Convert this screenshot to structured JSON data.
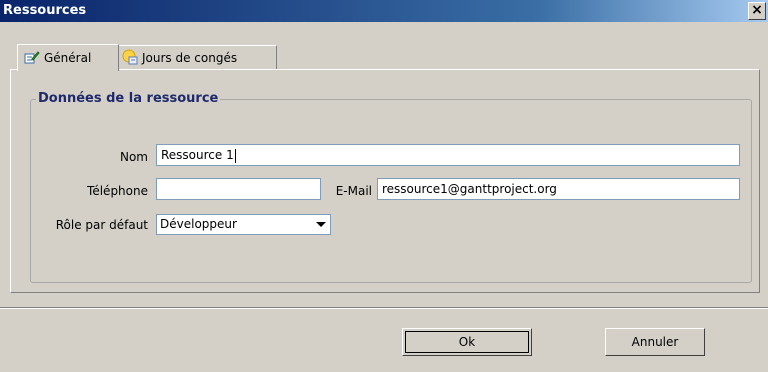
{
  "window": {
    "title": "Ressources",
    "close": "×"
  },
  "tabs": [
    {
      "label": "Général",
      "icon": "edit-icon",
      "active": true
    },
    {
      "label": "Jours de congés",
      "icon": "calendar-icon",
      "active": false
    }
  ],
  "group": {
    "title": "Données de la ressource"
  },
  "form": {
    "name": {
      "label": "Nom",
      "value": "Ressource 1"
    },
    "phone": {
      "label": "Téléphone",
      "value": ""
    },
    "email": {
      "label": "E-Mail",
      "value": "ressource1@ganttproject.org"
    },
    "role": {
      "label": "Rôle par défaut",
      "value": "Développeur"
    }
  },
  "buttons": {
    "ok": "Ok",
    "cancel": "Annuler"
  },
  "colors": {
    "title_bar": "#0a246a",
    "group_title": "#1f2a6c",
    "window_bg": "#d4d0c8"
  }
}
